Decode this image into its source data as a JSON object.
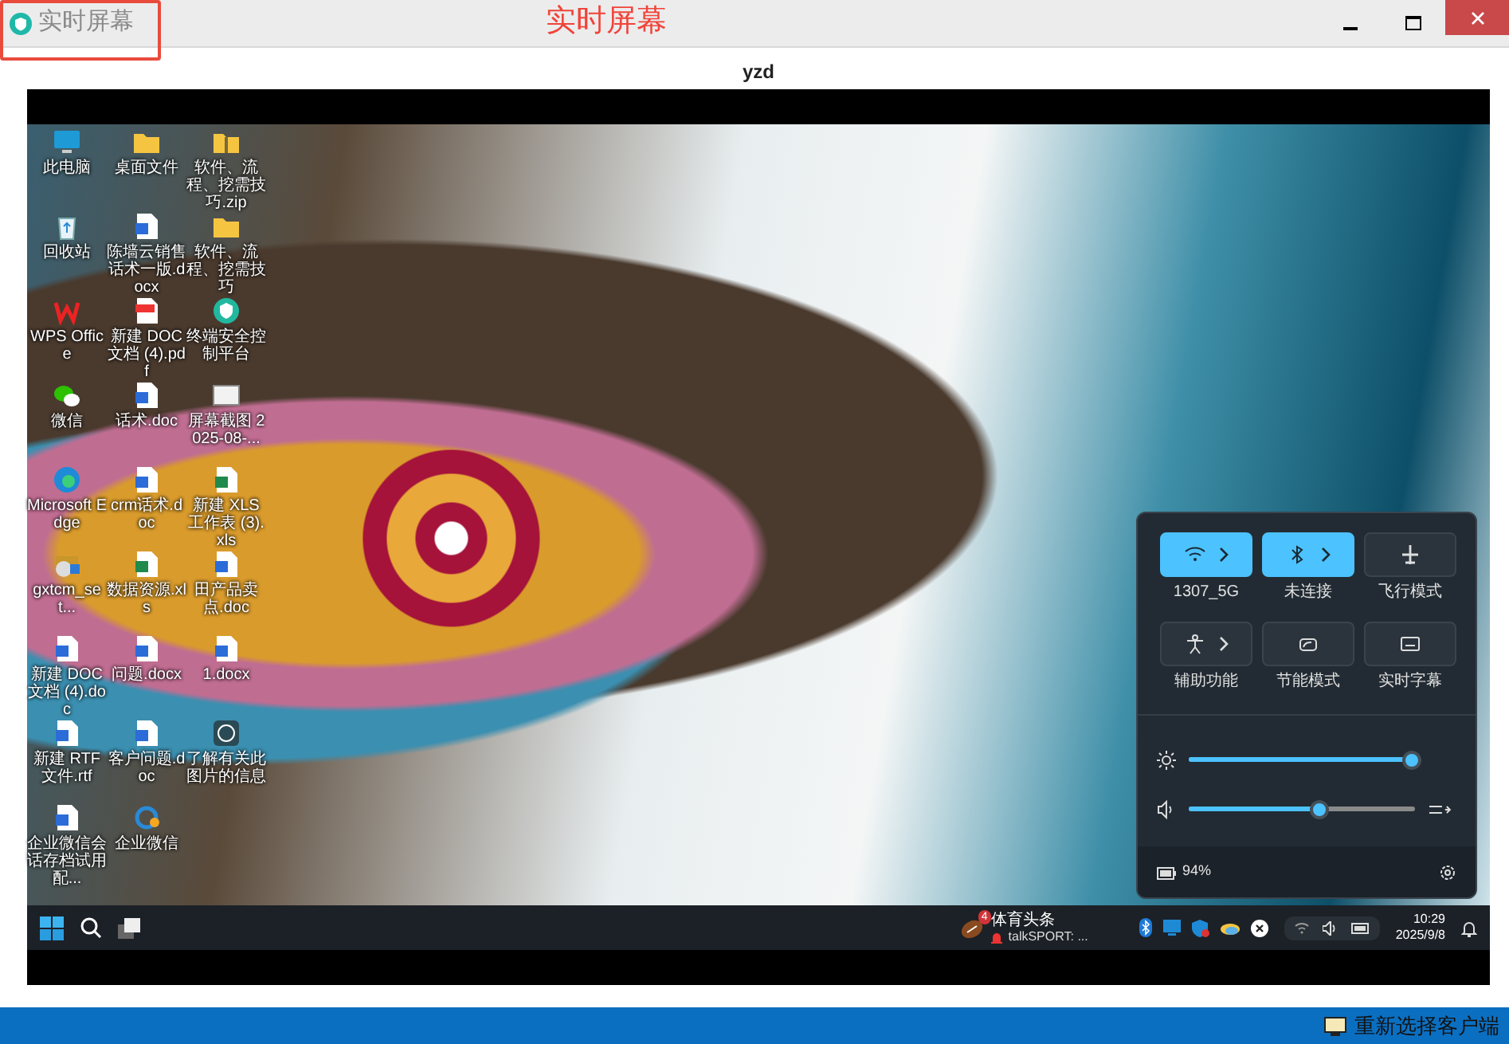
{
  "window": {
    "title": "实时屏幕"
  },
  "annotation": {
    "label": "实时屏幕"
  },
  "client_name": "yzd",
  "remote_desktop": {
    "icons": [
      {
        "label": "此电脑",
        "kind": "pc"
      },
      {
        "label": "桌面文件",
        "kind": "folder"
      },
      {
        "label": "软件、流程、挖需技巧.zip",
        "kind": "zip"
      },
      {
        "label": "回收站",
        "kind": "recycle"
      },
      {
        "label": "陈墙云销售话术一版.docx",
        "kind": "word"
      },
      {
        "label": "软件、流程、挖需技巧",
        "kind": "folder"
      },
      {
        "label": "WPS Office",
        "kind": "wps"
      },
      {
        "label": "新建 DOC 文档 (4).pdf",
        "kind": "pdf"
      },
      {
        "label": "终端安全控制平台",
        "kind": "shield"
      },
      {
        "label": "微信",
        "kind": "wechat"
      },
      {
        "label": "话术.doc",
        "kind": "word"
      },
      {
        "label": "屏幕截图 2025-08-...",
        "kind": "image"
      },
      {
        "label": "Microsoft Edge",
        "kind": "edge"
      },
      {
        "label": "crm话术.doc",
        "kind": "word"
      },
      {
        "label": "新建 XLS 工作表 (3).xls",
        "kind": "excel"
      },
      {
        "label": "gxtcm_set...",
        "kind": "setup"
      },
      {
        "label": "数据资源.xls",
        "kind": "excel"
      },
      {
        "label": "田产品卖点.doc",
        "kind": "word"
      },
      {
        "label": "新建 DOC 文档 (4).doc",
        "kind": "word"
      },
      {
        "label": "问题.docx",
        "kind": "word"
      },
      {
        "label": "1.docx",
        "kind": "word"
      },
      {
        "label": "新建 RTF 文件.rtf",
        "kind": "word"
      },
      {
        "label": "客户问题.doc",
        "kind": "word"
      },
      {
        "label": "了解有关此图片的信息",
        "kind": "info"
      },
      {
        "label": "企业微信会话存档试用配...",
        "kind": "word"
      },
      {
        "label": "企业微信",
        "kind": "wecom"
      }
    ],
    "quick_settings": {
      "tiles": [
        {
          "label": "1307_5G",
          "kind": "wifi",
          "on": true,
          "expandable": true
        },
        {
          "label": "未连接",
          "kind": "bluetooth",
          "on": true,
          "expandable": true
        },
        {
          "label": "飞行模式",
          "kind": "airplane",
          "on": false,
          "expandable": false
        },
        {
          "label": "辅助功能",
          "kind": "accessibility",
          "on": false,
          "expandable": true
        },
        {
          "label": "节能模式",
          "kind": "energy",
          "on": false,
          "expandable": false
        },
        {
          "label": "实时字幕",
          "kind": "captions",
          "on": false,
          "expandable": false
        }
      ],
      "brightness": {
        "level": 0.98
      },
      "volume": {
        "level": 0.58
      },
      "battery": "94%"
    },
    "taskbar": {
      "news": {
        "badge": "4",
        "title": "体育头条",
        "subtitle": "talkSPORT: ..."
      },
      "time": "10:29",
      "date": "2025/9/8"
    }
  },
  "footer": {
    "button": "重新选择客户端"
  }
}
